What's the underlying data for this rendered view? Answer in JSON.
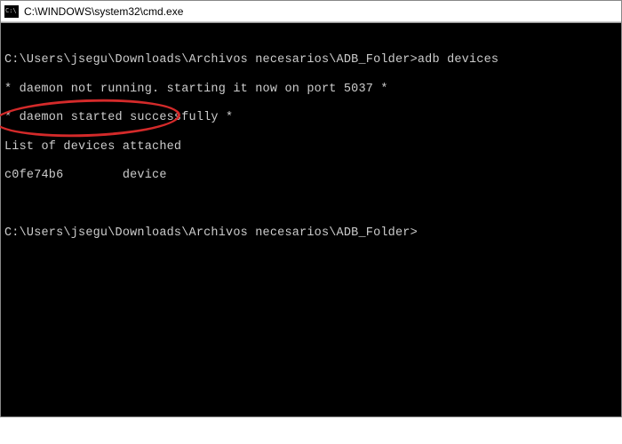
{
  "window": {
    "title": "C:\\WINDOWS\\system32\\cmd.exe",
    "icon_name": "cmd-icon"
  },
  "terminal": {
    "lines": [
      {
        "type": "blank",
        "text": ""
      },
      {
        "type": "prompt_cmd",
        "prompt": "C:\\Users\\jsegu\\Downloads\\Archivos necesarios\\ADB_Folder>",
        "command": "adb devices"
      },
      {
        "type": "output",
        "text": "* daemon not running. starting it now on port 5037 *"
      },
      {
        "type": "output",
        "text": "* daemon started successfully *"
      },
      {
        "type": "output",
        "text": "List of devices attached"
      },
      {
        "type": "output",
        "text": "c0fe74b6        device"
      },
      {
        "type": "blank",
        "text": ""
      },
      {
        "type": "blank",
        "text": ""
      },
      {
        "type": "prompt_cmd",
        "prompt": "C:\\Users\\jsegu\\Downloads\\Archivos necesarios\\ADB_Folder>",
        "command": ""
      }
    ]
  },
  "annotation": {
    "present": true,
    "color": "#d42a2a",
    "target_lines": [
      4,
      5
    ]
  }
}
